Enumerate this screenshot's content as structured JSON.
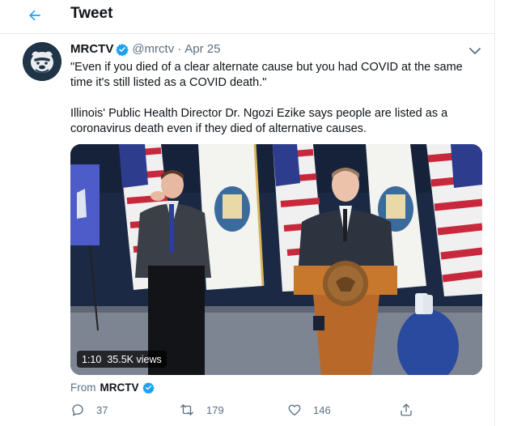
{
  "header": {
    "title": "Tweet"
  },
  "tweet": {
    "author_name": "MRCTV",
    "handle": "@mrctv",
    "separator": "·",
    "date": "Apr 25",
    "text_quote": "\"Even if you died of a clear alternate cause but you had COVID at the same time it's still listed as a COVID death.\"",
    "text_body": "Illinois' Public Health Director Dr. Ngozi Ezike says people are listed as a coronavirus death even if they died of alternative causes."
  },
  "media": {
    "duration": "1:10",
    "views": "35.5K views"
  },
  "source": {
    "label": "From",
    "name": "MRCTV"
  },
  "actions": {
    "replies": "37",
    "retweets": "179",
    "likes": "146"
  },
  "colors": {
    "accent": "#1da1f2",
    "secondary_text": "#5b7083",
    "border": "#e6ecf0"
  },
  "icons": [
    "back-arrow-icon",
    "verified-icon",
    "chevron-down-icon",
    "reply-icon",
    "retweet-icon",
    "like-icon",
    "share-icon"
  ]
}
